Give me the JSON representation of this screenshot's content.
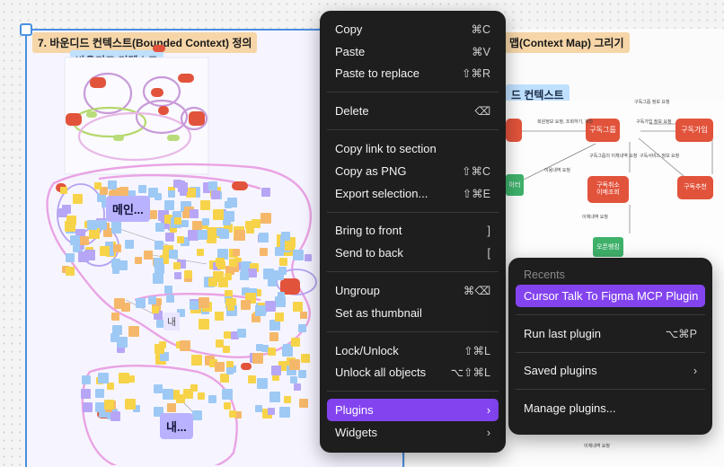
{
  "canvas": {
    "left_section": {
      "title": "7. 바운디드 컨텍스트(Bounded Context) 정의",
      "context_label": "바운디드 컨텍스트",
      "group_label_1": "메인...",
      "group_label_2": "내...",
      "small_label": "내"
    },
    "right_section": {
      "title": "맵(Context Map) 그리기",
      "context_label": "드 컨텍스트",
      "nodes": [
        "구독그룹",
        "구독가입",
        "구독취소\n이메조회",
        "구독추천",
        "이터",
        "오픈뱅킹"
      ],
      "edge_labels": [
        "구독그룹 정보 요청",
        "회원정보 요청, 조회하기, 계좌",
        "구독가입 정보 요청",
        "구독그룹의 이체내역 요청",
        "구독서비스 정보 요청",
        "이용내역 요청",
        "이체내역 요청",
        "이체내역 요청"
      ]
    }
  },
  "context_menu": {
    "items": [
      {
        "label": "Copy",
        "shortcut": "⌘C"
      },
      {
        "label": "Paste",
        "shortcut": "⌘V"
      },
      {
        "label": "Paste to replace",
        "shortcut": "⇧⌘R"
      },
      {
        "label": "Delete",
        "shortcut": "⌫"
      },
      {
        "label": "Copy link to section",
        "shortcut": ""
      },
      {
        "label": "Copy as PNG",
        "shortcut": "⇧⌘C"
      },
      {
        "label": "Export selection...",
        "shortcut": "⇧⌘E"
      },
      {
        "label": "Bring to front",
        "shortcut": "]"
      },
      {
        "label": "Send to back",
        "shortcut": "["
      },
      {
        "label": "Ungroup",
        "shortcut": "⌘⌫"
      },
      {
        "label": "Set as thumbnail",
        "shortcut": ""
      },
      {
        "label": "Lock/Unlock",
        "shortcut": "⇧⌘L"
      },
      {
        "label": "Unlock all objects",
        "shortcut": "⌥⇧⌘L"
      },
      {
        "label": "Plugins",
        "shortcut": "›"
      },
      {
        "label": "Widgets",
        "shortcut": "›"
      }
    ]
  },
  "plugins_submenu": {
    "recents_heading": "Recents",
    "recent_plugin": "Cursor Talk To Figma MCP Plugin",
    "run_last": {
      "label": "Run last plugin",
      "shortcut": "⌥⌘P"
    },
    "saved": {
      "label": "Saved plugins",
      "shortcut": "›"
    },
    "manage": {
      "label": "Manage plugins..."
    }
  },
  "colors": {
    "menu_bg": "#1e1e1e",
    "highlight": "#8344f0",
    "selection": "#4a90e2",
    "section_title_bg": "#f6d6a8",
    "context_label_bg": "#bfe0ff"
  }
}
